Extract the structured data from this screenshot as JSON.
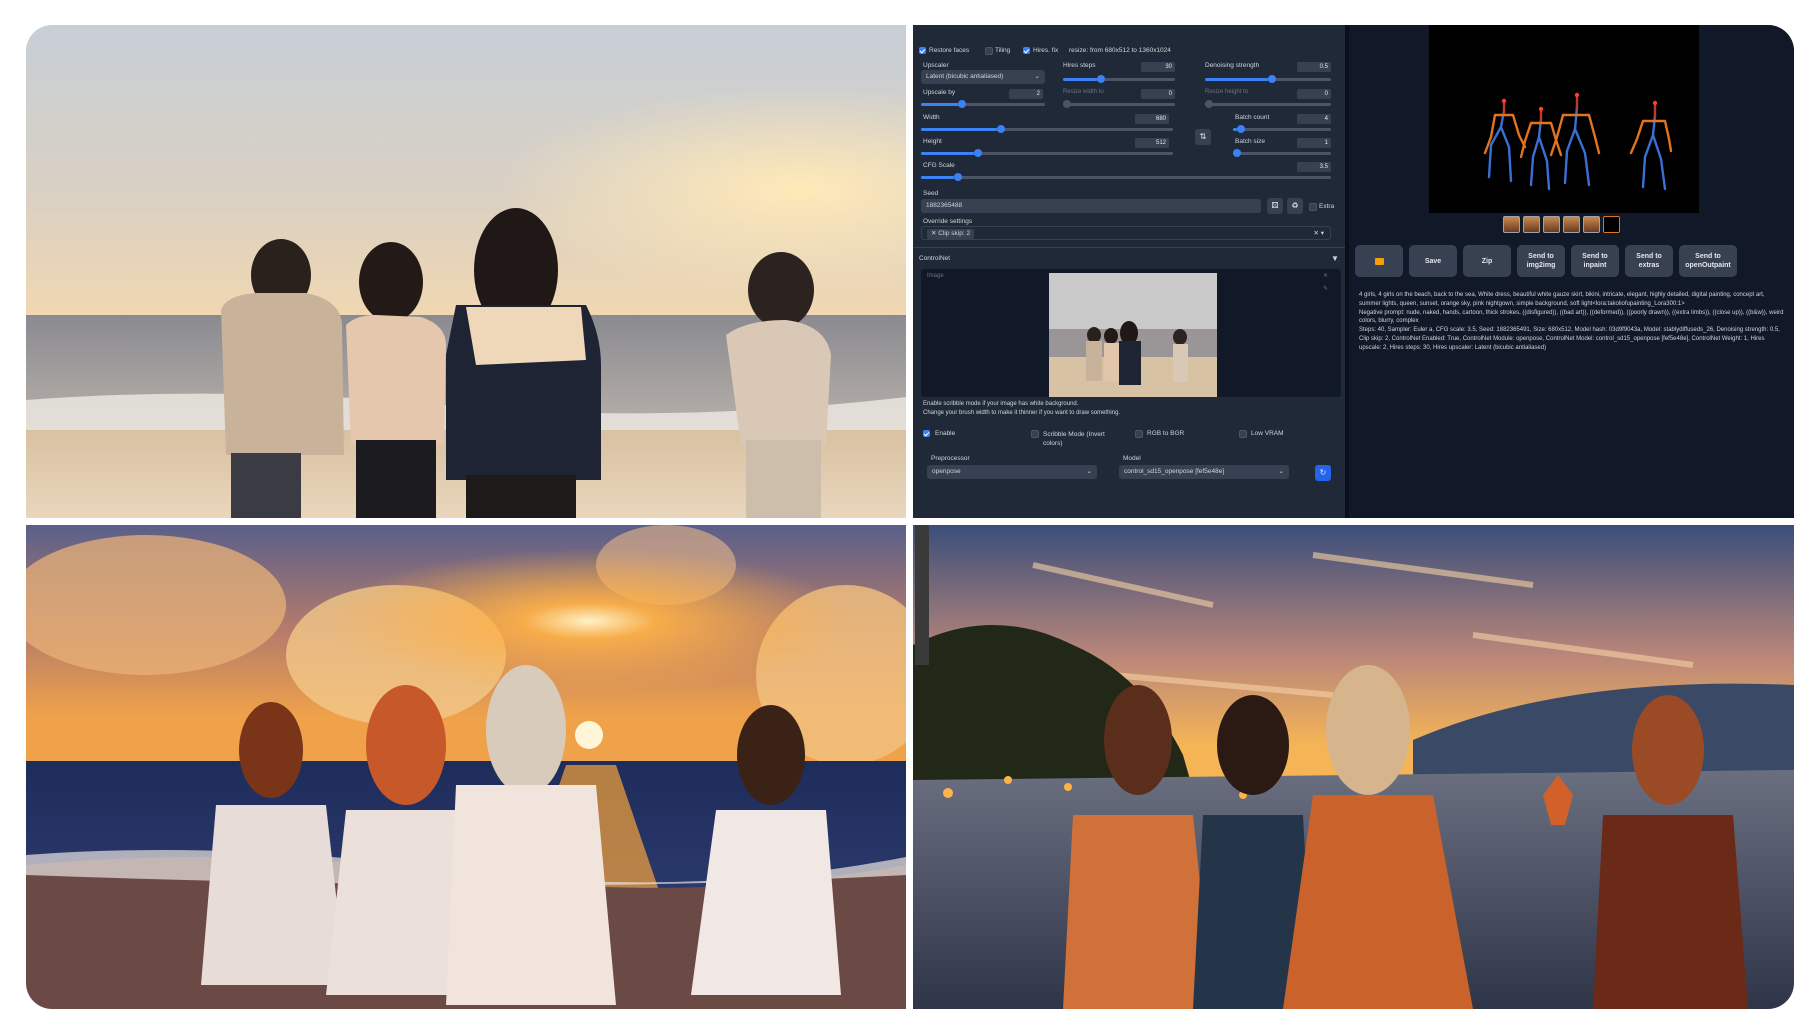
{
  "webui": {
    "face_restore_label": "Restore faces",
    "tiling_label": "Tiling",
    "hires_fix_label": "Hires. fix",
    "hires_resize_text": "resize: from 680x512 to 1360x1024",
    "upscaler_label": "Upscaler",
    "upscaler_value": "Latent (bicubic antialiased)",
    "hires_steps_label": "Hires steps",
    "hires_steps_value": "30",
    "denoise_label": "Denoising strength",
    "denoise_value": "0.5",
    "upscale_by_label": "Upscale by",
    "upscale_by_value": "2",
    "resize_width_label": "Resize width to",
    "resize_width_value": "0",
    "resize_height_label": "Resize height to",
    "resize_height_value": "0",
    "width_label": "Width",
    "width_value": "680",
    "height_label": "Height",
    "height_value": "512",
    "swap_icon": "⇅",
    "batch_count_label": "Batch count",
    "batch_count_value": "4",
    "batch_size_label": "Batch size",
    "batch_size_value": "1",
    "cfg_label": "CFG Scale",
    "cfg_value": "3.5",
    "seed_label": "Seed",
    "seed_value": "1882365488",
    "extra_label": "Extra",
    "override_label": "Override settings",
    "override_chip": "Clip skip: 2",
    "controlnet_label": "ControlNet",
    "image_label": "Image",
    "scribble_hint_1": "Enable scribble mode if your image has white background.",
    "scribble_hint_2": "Change your brush width to make it thinner if you want to draw something.",
    "enable_label": "Enable",
    "scribble_mode_label": "Scribble Mode (Invert colors)",
    "rgb_bgr_label": "RGB to BGR",
    "low_vram_label": "Low VRAM",
    "preprocessor_label": "Preprocessor",
    "preprocessor_value": "openpose",
    "model_label": "Model",
    "model_value": "control_sd15_openpose [fef5e48e]",
    "output_buttons": [
      {
        "label": "",
        "icon": "folder-icon"
      },
      {
        "label": "Save"
      },
      {
        "label": "Zip"
      },
      {
        "label": "Send to img2img"
      },
      {
        "label": "Send to inpaint"
      },
      {
        "label": "Send to extras"
      },
      {
        "label": "Send to openOutpaint"
      }
    ],
    "prompt_text": "4 girls, 4 girls on the beach, back to the sea, White dress, beautiful white gauze skirt, bikini, intricate, elegant, highly detailed, digital painting, concept art, summer lights, queen, sunset, orange sky, pink nightgown, simple background, soft light<lora:takoliofupainting_Lora300:1>",
    "negative_text": "Negative prompt: nude, naked, hands, cartoon, thick strokes, ((disfigured)), ((bad art)), ((deformed)), ((poorly drawn)), ((extra limbs)), ((close up)), ((b&w)), weird colors, blurry, complex",
    "params_text": "Steps: 40, Sampler: Euler a, CFG scale: 3.5, Seed: 1882365491, Size: 680x512, Model hash: 03d9f9043a, Model: stablydiffuseds_26, Denoising strength: 0.5, Clip skip: 2, ControlNet Enabled: True, ControlNet Module: openpose, ControlNet Model: control_sd15_openpose [fef5e48e], ControlNet Weight: 1, Hires upscale: 2, Hires steps: 30, Hires upscaler: Latent (bicubic antialiased)"
  },
  "colors": {
    "ui_bg": "#1f2937",
    "ui_dark": "#0b0f19",
    "accent": "#3b82f6",
    "pose_blue": "#3b6fd4",
    "pose_orange": "#e2731f"
  }
}
